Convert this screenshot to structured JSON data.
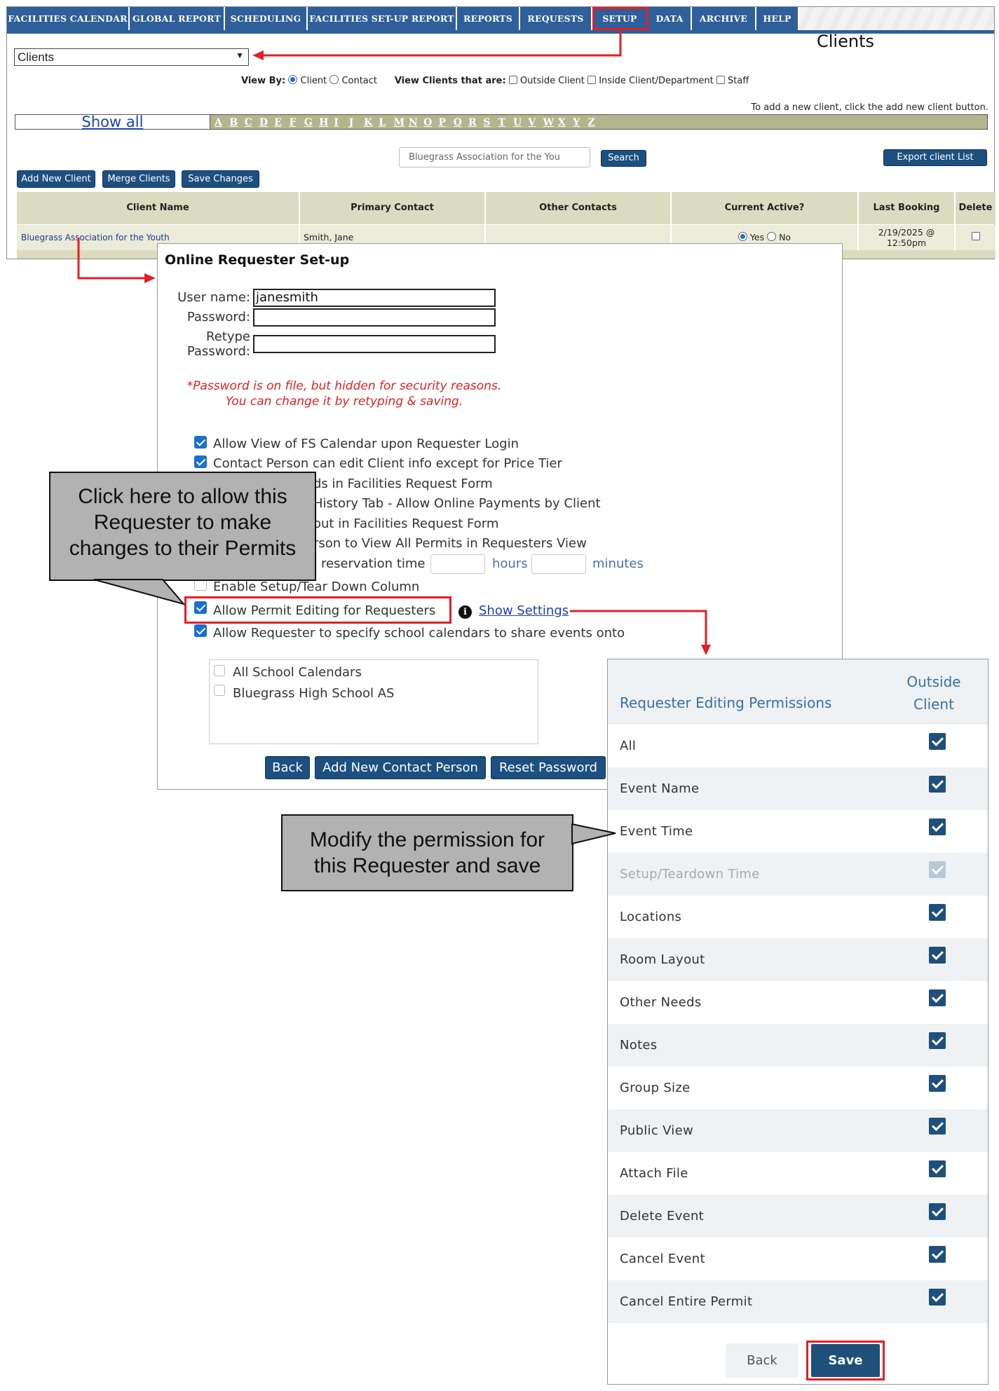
{
  "nav": {
    "tabs": [
      {
        "label": "FACILITIES CALENDAR"
      },
      {
        "label": "GLOBAL REPORT"
      },
      {
        "label": "SCHEDULING"
      },
      {
        "label": "FACILITIES SET-UP REPORT"
      },
      {
        "label": "REPORTS"
      },
      {
        "label": "REQUESTS"
      },
      {
        "label": "SETUP",
        "active": true
      },
      {
        "label": "DATA"
      },
      {
        "label": "ARCHIVE"
      },
      {
        "label": "HELP"
      }
    ]
  },
  "clients_page": {
    "select_value": "Clients",
    "heading": "Clients",
    "view_by_label": "View By:",
    "view_by_client": "Client",
    "view_by_contact": "Contact",
    "view_that_are_label": "View Clients that are:",
    "filter_outside": "Outside Client",
    "filter_inside": "Inside Client/Department",
    "filter_staff": "Staff",
    "add_hint": "To add a new client, click the add new client button.",
    "show_all": "Show all",
    "letters": [
      "A",
      "B",
      "C",
      "D",
      "E",
      "F",
      "G",
      "H",
      "I",
      "J",
      "K",
      "L",
      "M",
      "N",
      "O",
      "P",
      "Q",
      "R",
      "S",
      "T",
      "U",
      "V",
      "W",
      "X",
      "Y",
      "Z"
    ],
    "search_value": "Bluegrass Association for the You",
    "search_button": "Search",
    "export_button": "Export client List",
    "add_new_client_button": "Add New Client",
    "merge_clients_button": "Merge Clients",
    "save_changes_button": "Save Changes",
    "columns": {
      "client_name": "Client Name",
      "primary_contact": "Primary Contact",
      "other_contacts": "Other Contacts",
      "current_active": "Current Active?",
      "last_booking": "Last Booking",
      "delete": "Delete"
    },
    "row": {
      "client_name": "Bluegrass Association for the Youth",
      "primary_contact": "Smith, Jane",
      "other_contacts": "",
      "active_yes": "Yes",
      "active_no": "No",
      "last_booking_date": "2/19/2025 @",
      "last_booking_time": "12:50pm"
    }
  },
  "setup_dialog": {
    "title": "Online Requester Set-up",
    "username_label": "User name:",
    "username_value": "janesmith",
    "password_label": "Password:",
    "retype_label_1": "Retype",
    "retype_label_2": "Password:",
    "password_note_1": "*Password is on file, but hidden for security reasons.",
    "password_note_2": "You can change it by retyping & saving.",
    "options": {
      "view_calendar": "Allow View of FS Calendar upon Requester Login",
      "edit_client_info": "Contact Person can edit Client info except for Price Tier",
      "fields_partial": "ds in Facilities Request Form",
      "history_partial": "History Tab - Allow Online Payments by Client",
      "layout_partial": "out in Facilities Request Form",
      "view_permits_partial": "rson to View All Permits in Requesters View",
      "reservation_partial": "reservation time",
      "hours": "hours",
      "minutes": "minutes",
      "setup_teardown": "Enable Setup/Tear Down Column",
      "permit_editing": "Allow Permit Editing for Requesters",
      "show_settings": "Show Settings",
      "school_calendars": "Allow Requester to specify school calendars to share events onto"
    },
    "calendars": [
      "All School Calendars",
      "Bluegrass High School AS"
    ],
    "buttons": {
      "back": "Back",
      "add_contact": "Add New Contact Person",
      "reset_password": "Reset Password"
    }
  },
  "permissions": {
    "title": "Requester Editing Permissions",
    "column_line1": "Outside",
    "column_line2": "Client",
    "rows": [
      {
        "label": "All",
        "checked": true
      },
      {
        "label": "Event Name",
        "checked": true
      },
      {
        "label": "Event Time",
        "checked": true
      },
      {
        "label": "Setup/Teardown Time",
        "checked": true,
        "disabled": true
      },
      {
        "label": "Locations",
        "checked": true
      },
      {
        "label": "Room Layout",
        "checked": true
      },
      {
        "label": "Other Needs",
        "checked": true
      },
      {
        "label": "Notes",
        "checked": true
      },
      {
        "label": "Group Size",
        "checked": true
      },
      {
        "label": "Public View",
        "checked": true
      },
      {
        "label": "Attach File",
        "checked": true
      },
      {
        "label": "Delete Event",
        "checked": true
      },
      {
        "label": "Cancel Event",
        "checked": true
      },
      {
        "label": "Cancel Entire Permit",
        "checked": true
      }
    ],
    "back_button": "Back",
    "save_button": "Save"
  },
  "callouts": {
    "permit_line1": "Click here to allow this",
    "permit_line2": "Requester to make",
    "permit_line3": "changes to their Permits",
    "modify_line1": "Modify the permission for",
    "modify_line2": "this Requester and save"
  },
  "colors": {
    "nav_blue": "#2e5f9a",
    "button_navy": "#1d4f7f",
    "checkbox_navy": "#1f4f7b",
    "highlight_red": "#e31e24",
    "table_header": "#dbdbc1",
    "callout_gray": "#b2b2b2"
  }
}
